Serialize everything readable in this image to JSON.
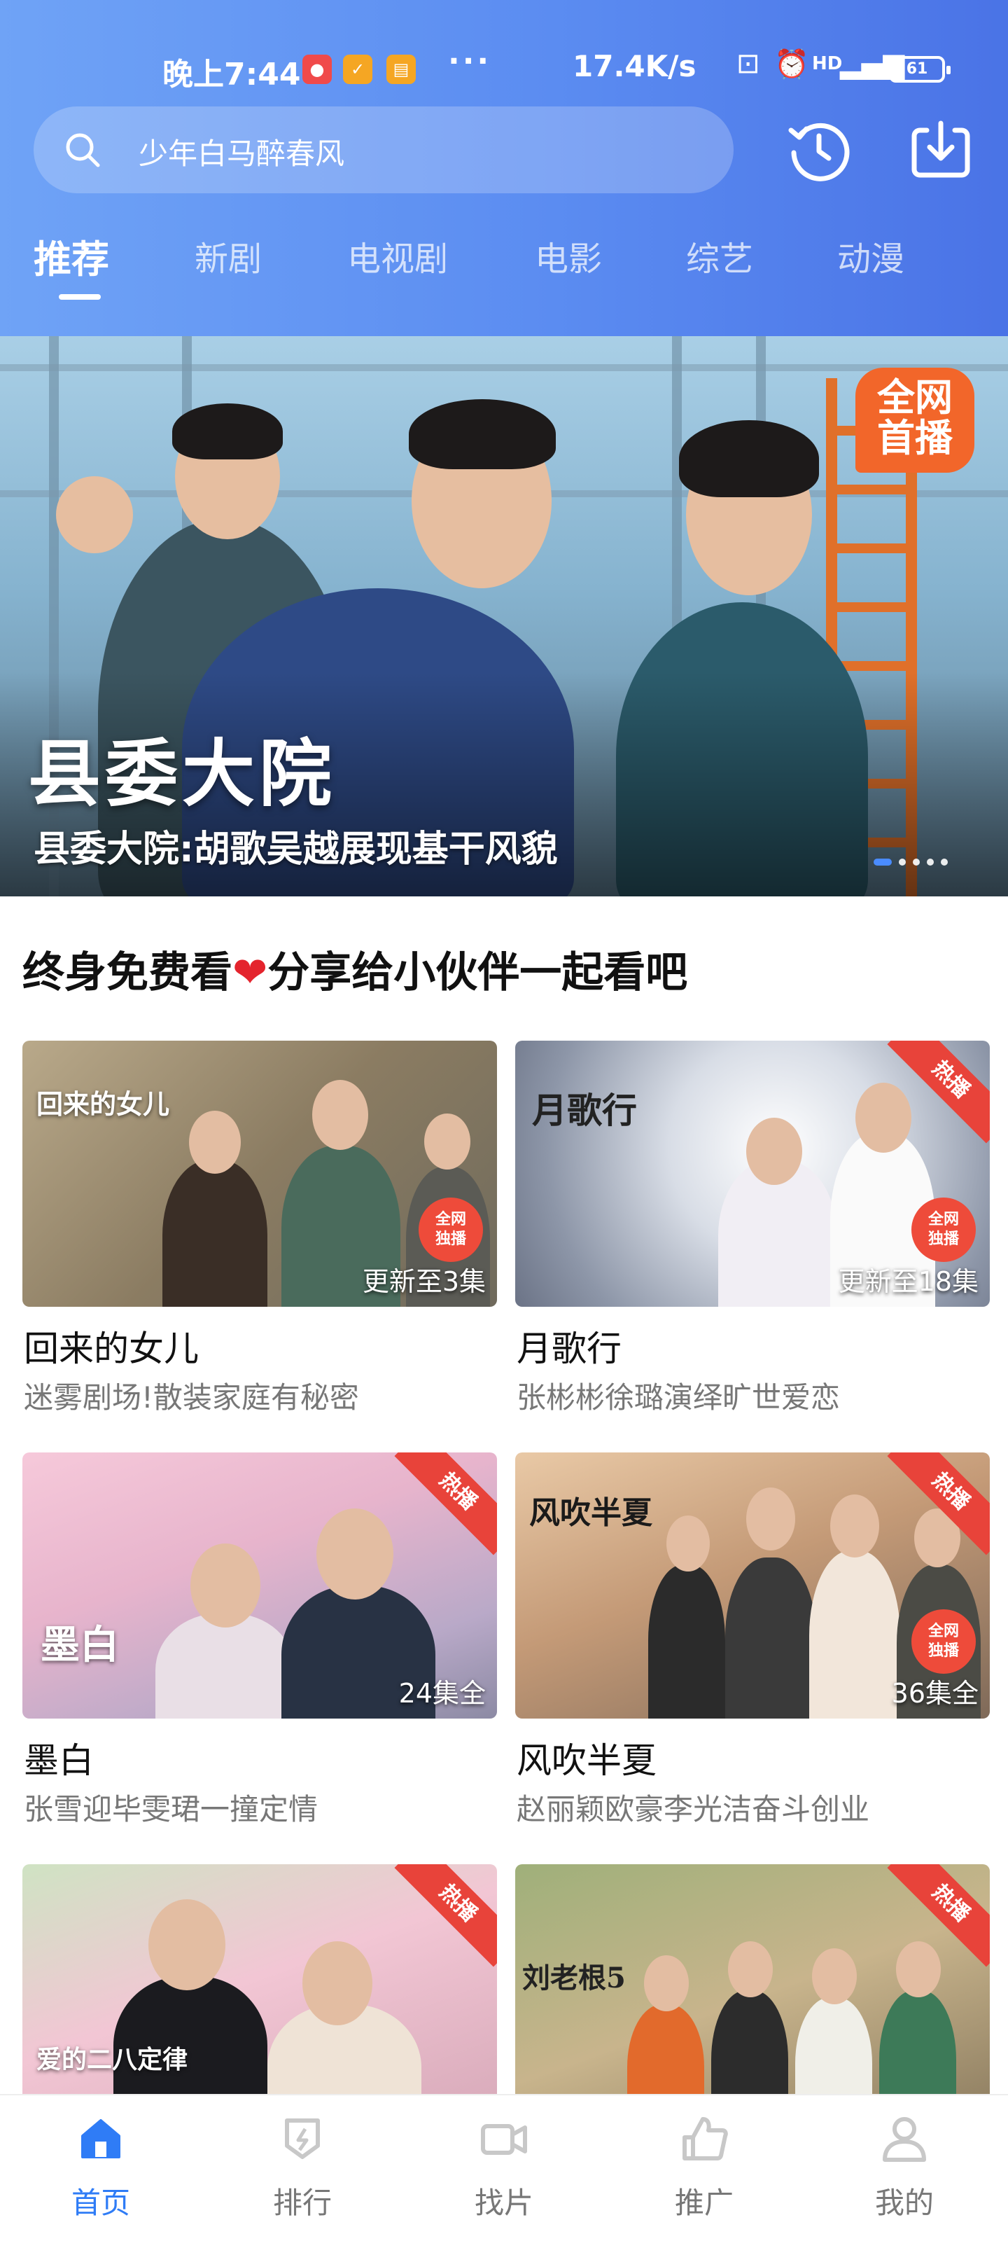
{
  "status_bar": {
    "time": "晚上7:44",
    "more": "···",
    "network_speed": "17.4K/s",
    "signal_label": "HD",
    "battery": "61"
  },
  "search": {
    "placeholder": "少年白马醉春风"
  },
  "tabs": [
    {
      "label": "推荐",
      "active": true
    },
    {
      "label": "新剧",
      "active": false
    },
    {
      "label": "电视剧",
      "active": false
    },
    {
      "label": "电影",
      "active": false
    },
    {
      "label": "综艺",
      "active": false
    },
    {
      "label": "动漫",
      "active": false
    }
  ],
  "banner": {
    "poster_title": "县委大院",
    "caption": "县委大院:胡歌吴越展现基干风貌",
    "badge": "全网\n首播",
    "slide_count": 5,
    "active_slide": 0
  },
  "section": {
    "title_before_heart": "终身免费看",
    "title_after_heart": "分享给小伙伴一起看吧"
  },
  "cards": [
    {
      "title": "回来的女儿",
      "subtitle": "迷雾剧场!散装家庭有秘密",
      "episodes": "更新至3集",
      "hot": false,
      "badge": "全网\n独播",
      "poster_text": "回来的女儿"
    },
    {
      "title": "月歌行",
      "subtitle": "张彬彬徐璐演绎旷世爱恋",
      "episodes": "更新至18集",
      "hot": true,
      "hot_label": "热播",
      "badge": "全网\n独播",
      "poster_text": "月歌行"
    },
    {
      "title": "墨白",
      "subtitle": "张雪迎毕雯珺一撞定情",
      "episodes": "24集全",
      "hot": true,
      "hot_label": "热播",
      "poster_text": "墨白"
    },
    {
      "title": "风吹半夏",
      "subtitle": "赵丽颖欧豪李光洁奋斗创业",
      "episodes": "36集全",
      "hot": true,
      "hot_label": "热播",
      "badge": "全网\n独播",
      "poster_text": "风吹半夏"
    },
    {
      "title": "",
      "subtitle": "",
      "episodes": "",
      "hot": true,
      "hot_label": "热播",
      "poster_text": "爱的二八定律"
    },
    {
      "title": "",
      "subtitle": "",
      "episodes": "",
      "hot": true,
      "hot_label": "热播",
      "poster_text": "刘老根5"
    }
  ],
  "bottom_nav": [
    {
      "label": "首页",
      "icon": "home-icon",
      "active": true
    },
    {
      "label": "排行",
      "icon": "ranking-icon",
      "active": false
    },
    {
      "label": "找片",
      "icon": "video-search-icon",
      "active": false
    },
    {
      "label": "推广",
      "icon": "thumbs-up-icon",
      "active": false
    },
    {
      "label": "我的",
      "icon": "profile-icon",
      "active": false
    }
  ],
  "colors": {
    "header_gradient_start": "#6fa3f6",
    "header_gradient_end": "#4a73e6",
    "accent": "#2f7cf6",
    "hot_badge": "#e8433a"
  }
}
